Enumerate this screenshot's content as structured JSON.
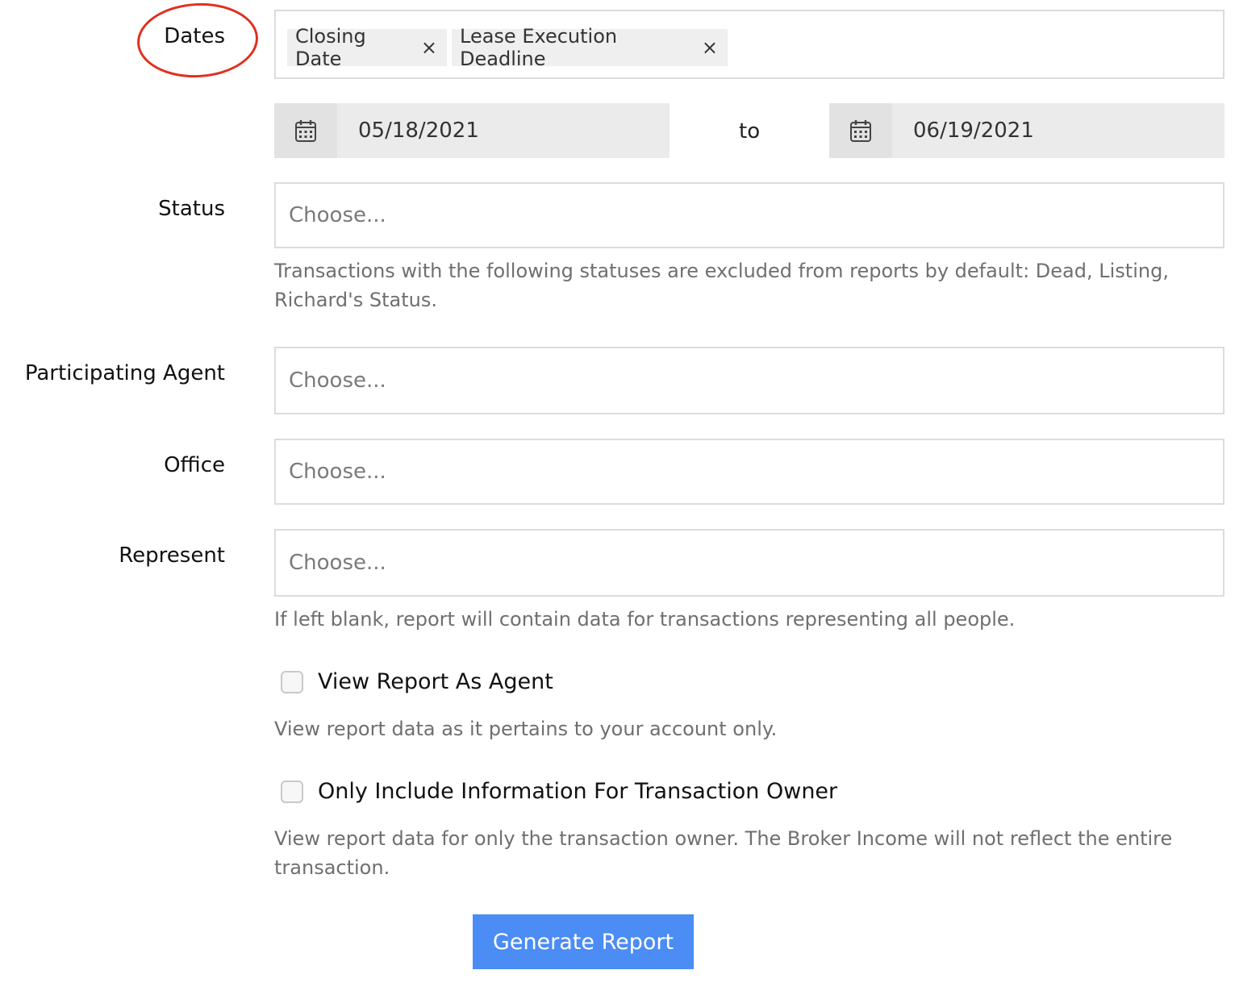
{
  "dates": {
    "label": "Dates",
    "tags": [
      "Closing Date",
      "Lease Execution Deadline"
    ],
    "tag_remove_symbol": "×",
    "from_date": "05/18/2021",
    "to_label": "to",
    "to_date": "06/19/2021"
  },
  "status": {
    "label": "Status",
    "placeholder": "Choose...",
    "help": "Transactions with the following statuses are excluded from reports by default: Dead, Listing, Richard's Status."
  },
  "participating_agent": {
    "label": "Participating Agent",
    "placeholder": "Choose..."
  },
  "office": {
    "label": "Office",
    "placeholder": "Choose..."
  },
  "represent": {
    "label": "Represent",
    "placeholder": "Choose...",
    "help": "If left blank, report will contain data for transactions representing all people."
  },
  "view_as_agent": {
    "label": "View Report As Agent",
    "checked": false,
    "help": "View report data as it pertains to your account only."
  },
  "owner_only": {
    "label": "Only Include Information For Transaction Owner",
    "checked": false,
    "help": "View report data for only the transaction owner. The Broker Income will not reflect the entire transaction."
  },
  "generate_button": "Generate Report",
  "colors": {
    "accent": "#4b8cf5",
    "annotation": "#e0301e"
  }
}
